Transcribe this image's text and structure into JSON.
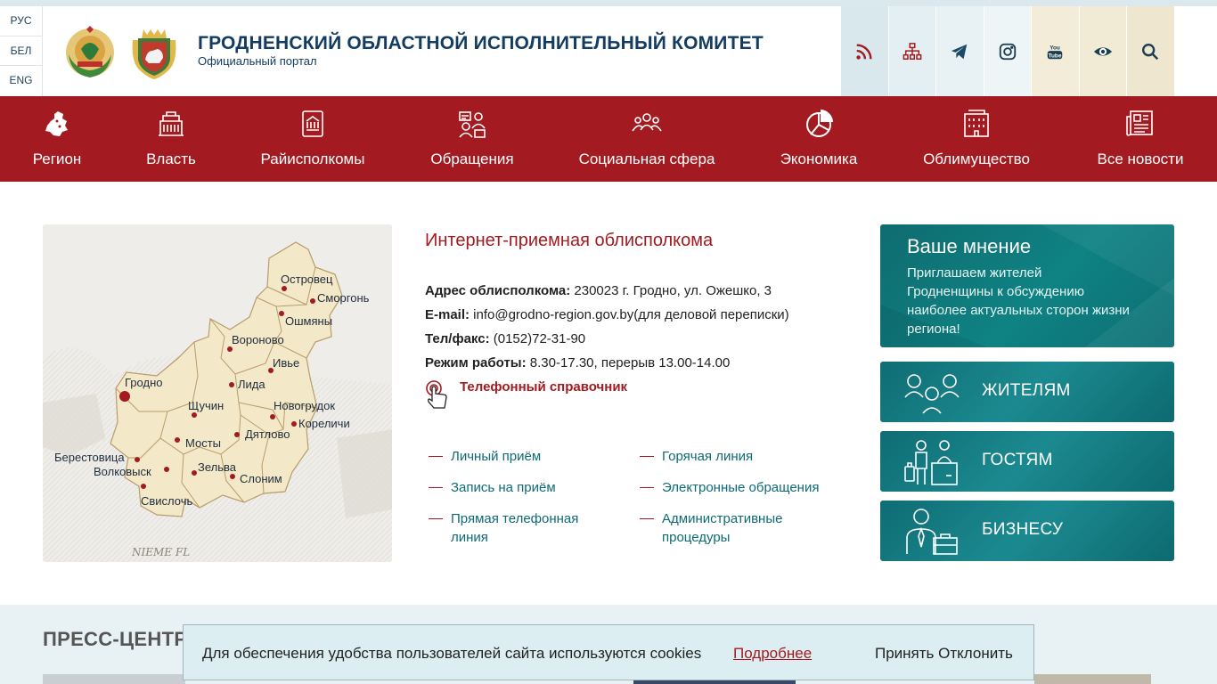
{
  "languages": [
    "РУС",
    "БЕЛ",
    "ENG"
  ],
  "header": {
    "title": "ГРОДНЕНСКИЙ ОБЛАСТНОЙ ИСПОЛНИТЕЛЬНЫЙ КОМИТЕТ",
    "subtitle": "Официальный портал",
    "buttons": [
      {
        "icon": "rss-icon",
        "bg": "#d8e8ed"
      },
      {
        "icon": "sitemap-icon",
        "bg": "#e3eff2"
      },
      {
        "icon": "telegram-icon",
        "bg": "#e8f2f4"
      },
      {
        "icon": "instagram-icon",
        "bg": "#edf5f6"
      },
      {
        "icon": "youtube-icon",
        "bg": "#f2ecd9"
      },
      {
        "icon": "eye-icon",
        "bg": "#f1ead5"
      },
      {
        "icon": "search-icon",
        "bg": "#efe6cf"
      }
    ],
    "youtube_text": "You Tube"
  },
  "nav": [
    {
      "label": "Регион",
      "icon": "region-icon"
    },
    {
      "label": "Власть",
      "icon": "government-icon"
    },
    {
      "label": "Райисполкомы",
      "icon": "district-icon"
    },
    {
      "label": "Обращения",
      "icon": "appeals-icon"
    },
    {
      "label": "Социальная сфера",
      "icon": "social-icon"
    },
    {
      "label": "Экономика",
      "icon": "economy-icon"
    },
    {
      "label": "Облимущество",
      "icon": "property-icon"
    },
    {
      "label": "Все новости",
      "icon": "news-icon"
    }
  ],
  "map": {
    "cities": [
      "Островец",
      "Сморгонь",
      "Ошмяны",
      "Вороново",
      "Ивье",
      "Лида",
      "Гродно",
      "Щучин",
      "Новогрудок",
      "Кореличи",
      "Дятлово",
      "Мосты",
      "Берестовица",
      "Волковыск",
      "Зельва",
      "Слоним",
      "Свислочь"
    ],
    "watermark": "NIEME FL"
  },
  "reception": {
    "title": "Интернет-приемная облисполкома",
    "address_label": "Адрес облисполкома:",
    "address_value": " 230023 г. Гродно, ул. Ожешко, 3",
    "email_label": "E-mail:",
    "email_value": " info@grodno-region.gov.by(для деловой переписки)",
    "phone_label": "Тел/факс:",
    "phone_value": " (0152)72-31-90",
    "hours_label": "Режим работы:",
    "hours_value": " 8.30-17.30, перерыв 13.00-14.00",
    "phonebook": "Телефонный справочник",
    "links_left": [
      "Личный приём",
      "Запись на приём",
      "Прямая телефонная линия"
    ],
    "links_right": [
      "Горячая линия",
      "Электронные обращения",
      "Административные процедуры"
    ]
  },
  "opinion": {
    "title": "Ваше мнение",
    "text": "Приглашаем жителей Гродненщины к обсуждению наиболее актуальных сторон жизни региона!"
  },
  "audiences": [
    "ЖИТЕЛЯМ",
    "ГОСТЯМ",
    "БИЗНЕСУ"
  ],
  "press": {
    "title": "ПРЕСС-ЦЕНТР"
  },
  "cookie": {
    "message": "Для обеспечения удобства пользователей сайта используются cookies",
    "more": "Подробнее",
    "accept": "Принять",
    "decline": "Отклонить"
  }
}
